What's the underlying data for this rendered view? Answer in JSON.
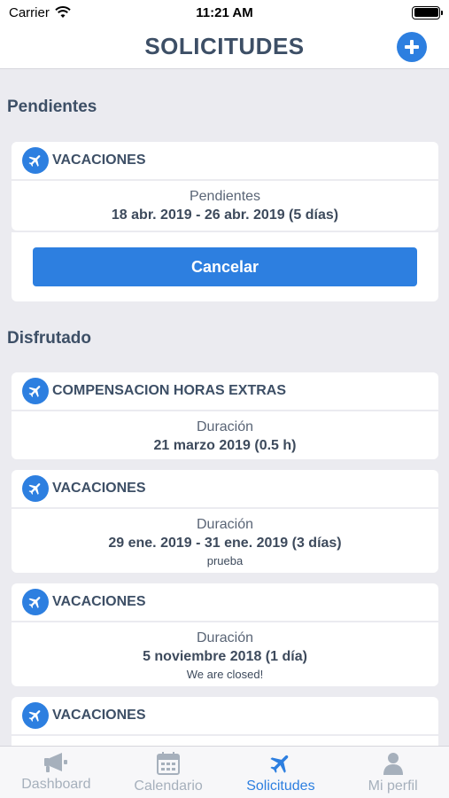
{
  "status_bar": {
    "carrier": "Carrier",
    "time": "11:21 AM"
  },
  "nav": {
    "title": "SOLICITUDES",
    "add_icon": "plus-circle-icon"
  },
  "sections": {
    "pending_title": "Pendientes",
    "enjoyed_title": "Disfrutado"
  },
  "pending": [
    {
      "type": "VACACIONES",
      "label": "Pendientes",
      "dates": "18 abr. 2019 - 26 abr. 2019 (5 días)",
      "button": "Cancelar"
    }
  ],
  "enjoyed": [
    {
      "type": "COMPENSACION HORAS EXTRAS",
      "label": "Duración",
      "dates": "21 marzo 2019 (0.5 h)",
      "note": ""
    },
    {
      "type": "VACACIONES",
      "label": "Duración",
      "dates": "29 ene. 2019 - 31 ene. 2019 (3 días)",
      "note": "prueba"
    },
    {
      "type": "VACACIONES",
      "label": "Duración",
      "dates": "5 noviembre 2018 (1 día)",
      "note": "We are closed!"
    },
    {
      "type": "VACACIONES",
      "label": "",
      "dates": "",
      "note": ""
    }
  ],
  "tabs": [
    {
      "label": "Dashboard",
      "icon": "megaphone-icon",
      "active": false
    },
    {
      "label": "Calendario",
      "icon": "calendar-icon",
      "active": false
    },
    {
      "label": "Solicitudes",
      "icon": "airplane-icon",
      "active": true
    },
    {
      "label": "Mi perfil",
      "icon": "person-icon",
      "active": false
    }
  ],
  "colors": {
    "accent": "#2d7fe0",
    "title": "#3d4f66",
    "background": "#ebebf0",
    "inactive_tab": "#a6b0bc"
  }
}
